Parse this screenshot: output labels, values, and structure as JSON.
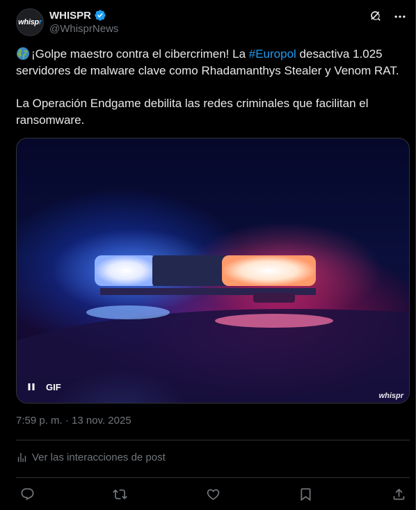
{
  "author": {
    "display_name": "WHISPR",
    "handle": "@WhisprNews",
    "avatar_text_main": "whisp",
    "avatar_text_accent": "r",
    "verified_color": "#1d9bf0"
  },
  "post": {
    "emoji": "globe-emoji",
    "line1_pre": "¡Golpe maestro contra el cibercrimen! La ",
    "hashtag": "#Europol",
    "line1_post": " desactiva 1.025 servidores de malware clave como Rhadamanthys Stealer y Venom RAT.",
    "paragraph2": "La Operación Endgame debilita las redes criminales que facilitan el ransomware."
  },
  "media": {
    "badge": "GIF",
    "watermark": "whispr"
  },
  "timestamp": "7:59 p. m. · 13 nov. 2025",
  "analytics_label": "Ver las interacciones de post",
  "icons": {
    "grok": "grok-icon",
    "more": "more-icon",
    "reply": "reply-icon",
    "repost": "repost-icon",
    "like": "like-icon",
    "bookmark": "bookmark-icon",
    "share": "share-icon"
  },
  "colors": {
    "background": "#000000",
    "text": "#e7e9ea",
    "muted": "#71767b",
    "accent": "#1d9bf0",
    "border": "#2f3336"
  }
}
